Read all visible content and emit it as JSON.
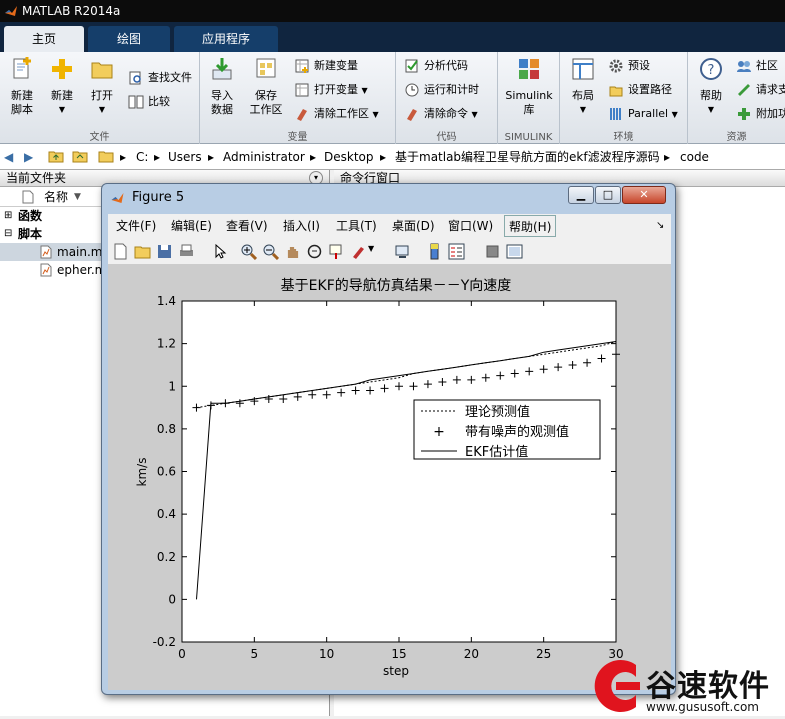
{
  "window": {
    "title": "MATLAB R2014a"
  },
  "tabs": [
    {
      "label": "主页"
    },
    {
      "label": "绘图"
    },
    {
      "label": "应用程序"
    }
  ],
  "ribbon": {
    "groups": [
      {
        "label": "文件",
        "buttons": [
          "新建\n脚本",
          "新建",
          "打开",
          "查找文件",
          "比较"
        ]
      },
      {
        "label": "变量",
        "buttons": [
          "导入\n数据",
          "保存\n工作区",
          "新建变量",
          "打开变量",
          "清除工作区"
        ]
      },
      {
        "label": "代码",
        "buttons": [
          "分析代码",
          "运行和计时",
          "清除命令"
        ]
      },
      {
        "label": "SIMULINK",
        "buttons": [
          "Simulink\n库"
        ]
      },
      {
        "label": "环境",
        "buttons": [
          "布局",
          "预设",
          "设置路径",
          "Parallel"
        ]
      },
      {
        "label": "资源",
        "buttons": [
          "帮助",
          "社区",
          "请求支",
          "附加功"
        ]
      }
    ]
  },
  "address": {
    "path": [
      "C:",
      "Users",
      "Administrator",
      "Desktop",
      "基于matlab编程卫星导航方面的ekf滤波程序源码",
      "code"
    ]
  },
  "file_browser": {
    "title": "当前文件夹",
    "column": "名称",
    "sections": [
      {
        "label": "函数",
        "collapsed": true
      },
      {
        "label": "脚本",
        "collapsed": false
      }
    ],
    "files": [
      "main.m",
      "epher.m"
    ]
  },
  "command_window": {
    "title": "命令行窗口"
  },
  "figure": {
    "title": "Figure 5",
    "menu": [
      "文件(F)",
      "编辑(E)",
      "查看(V)",
      "插入(I)",
      "工具(T)",
      "桌面(D)",
      "窗口(W)",
      "帮助(H)"
    ],
    "toolbar_icons": [
      "new-figure-icon",
      "open-icon",
      "save-icon",
      "print-icon",
      "pointer-icon",
      "zoom-in-icon",
      "zoom-out-icon",
      "pan-icon",
      "rotate-icon",
      "data-cursor-icon",
      "brush-icon",
      "link-icon",
      "colorbar-icon",
      "legend-icon",
      "hide-plot-tools-icon",
      "show-plot-tools-icon"
    ]
  },
  "chart_data": {
    "type": "line",
    "title": "基于EKF的导航仿真结果－－Y向速度",
    "xlabel": "step",
    "ylabel": "km/s",
    "xlim": [
      0,
      30
    ],
    "ylim": [
      -0.2,
      1.4
    ],
    "xticks": [
      0,
      5,
      10,
      15,
      20,
      25,
      30
    ],
    "yticks": [
      -0.2,
      0,
      0.2,
      0.4,
      0.6,
      0.8,
      1,
      1.2,
      1.4
    ],
    "grid": false,
    "legend_position": "center-right",
    "series": [
      {
        "name": "理论预测值",
        "style": "dotted",
        "x": [
          1,
          2,
          3,
          4,
          5,
          6,
          7,
          8,
          9,
          10,
          11,
          12,
          13,
          14,
          15,
          16,
          17,
          18,
          19,
          20,
          21,
          22,
          23,
          24,
          25,
          26,
          27,
          28,
          29,
          30
        ],
        "y": [
          0.9,
          0.91,
          0.92,
          0.93,
          0.94,
          0.95,
          0.96,
          0.97,
          0.98,
          0.99,
          1.0,
          1.01,
          1.02,
          1.03,
          1.04,
          1.06,
          1.07,
          1.08,
          1.09,
          1.1,
          1.11,
          1.12,
          1.13,
          1.14,
          1.15,
          1.16,
          1.17,
          1.18,
          1.19,
          1.21
        ]
      },
      {
        "name": "带有噪声的观测值",
        "style": "plus",
        "x": [
          1,
          2,
          3,
          4,
          5,
          6,
          7,
          8,
          9,
          10,
          11,
          12,
          13,
          14,
          15,
          16,
          17,
          18,
          19,
          20,
          21,
          22,
          23,
          24,
          25,
          26,
          27,
          28,
          29,
          30
        ],
        "y": [
          0.9,
          0.91,
          0.92,
          0.92,
          0.93,
          0.94,
          0.94,
          0.95,
          0.96,
          0.96,
          0.97,
          0.98,
          0.98,
          0.99,
          1.0,
          1.0,
          1.01,
          1.02,
          1.03,
          1.03,
          1.04,
          1.05,
          1.06,
          1.07,
          1.08,
          1.09,
          1.1,
          1.11,
          1.13,
          1.15
        ]
      },
      {
        "name": "EKF估计值",
        "style": "solid",
        "x": [
          1,
          2,
          3,
          4,
          5,
          6,
          7,
          8,
          9,
          10,
          11,
          12,
          13,
          14,
          15,
          16,
          17,
          18,
          19,
          20,
          21,
          22,
          23,
          24,
          25,
          26,
          27,
          28,
          29,
          30
        ],
        "y": [
          0.0,
          0.92,
          0.92,
          0.93,
          0.94,
          0.95,
          0.96,
          0.97,
          0.98,
          0.99,
          1.0,
          1.01,
          1.03,
          1.04,
          1.05,
          1.06,
          1.07,
          1.08,
          1.09,
          1.1,
          1.11,
          1.12,
          1.13,
          1.14,
          1.16,
          1.17,
          1.18,
          1.19,
          1.2,
          1.21
        ]
      }
    ]
  },
  "watermark": {
    "brand": "谷速软件",
    "url": "www.gususoft.com"
  },
  "colors": {
    "titlebar": "#0c0c0c",
    "tabbar": "#10253f",
    "tab_inactive": "#153e6a",
    "watermark_red": "#e0141e"
  }
}
